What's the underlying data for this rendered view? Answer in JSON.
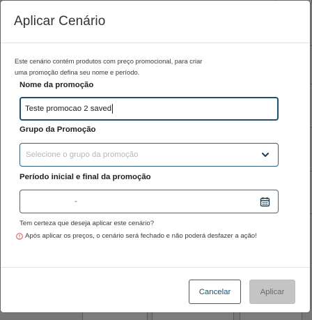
{
  "modal": {
    "title": "Aplicar Cenário",
    "intro_line1": "Este cenário contém produtos com preço promocional, para criar",
    "intro_line2": "uma promoção defina seu nome e período."
  },
  "form": {
    "name_label": "Nome da promoção",
    "name_value": "Teste promocao 2 saved",
    "group_label": "Grupo da Promoção",
    "group_placeholder": "Selecione o grupo da promoção",
    "period_label": "Período inicial e final da promoção",
    "period_separator": "-"
  },
  "messages": {
    "confirm": "Tem certeza que deseja aplicar este cenário?",
    "warning": "Após aplicar os preços, o cenário será fechado e não poderá desfazer a ação!"
  },
  "footer": {
    "cancel_label": "Cancelar",
    "apply_label": "Aplicar"
  },
  "colors": {
    "accent": "#1d4f6e",
    "warning": "#d9534f",
    "disabled_button": "#c4c4c4"
  },
  "icons": {
    "group_select": "chevron-down-icon",
    "period": "calendar-icon",
    "warning": "warning-circle-icon"
  }
}
